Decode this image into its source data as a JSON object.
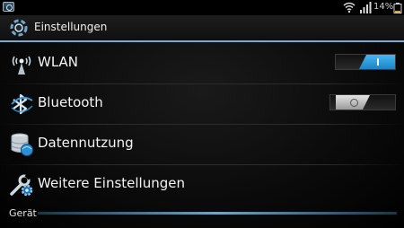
{
  "status_bar": {
    "battery_percent": "14%",
    "icons": [
      "app-icon",
      "wifi-icon",
      "signal-icon",
      "battery-icon"
    ]
  },
  "title_bar": {
    "title": "Einstellungen",
    "icon": "settings-icon"
  },
  "items": [
    {
      "label": "WLAN",
      "icon": "wlan-antenna-icon",
      "toggle": "on"
    },
    {
      "label": "Bluetooth",
      "icon": "bluetooth-icon",
      "toggle": "off"
    },
    {
      "label": "Datennutzung",
      "icon": "data-usage-icon"
    },
    {
      "label": "Weitere Einstellungen",
      "icon": "wrench-gear-icon"
    }
  ],
  "section": {
    "label": "Gerät"
  },
  "colors": {
    "accent": "#35a6e6",
    "background": "#000000",
    "text": "#f2f2f2"
  }
}
